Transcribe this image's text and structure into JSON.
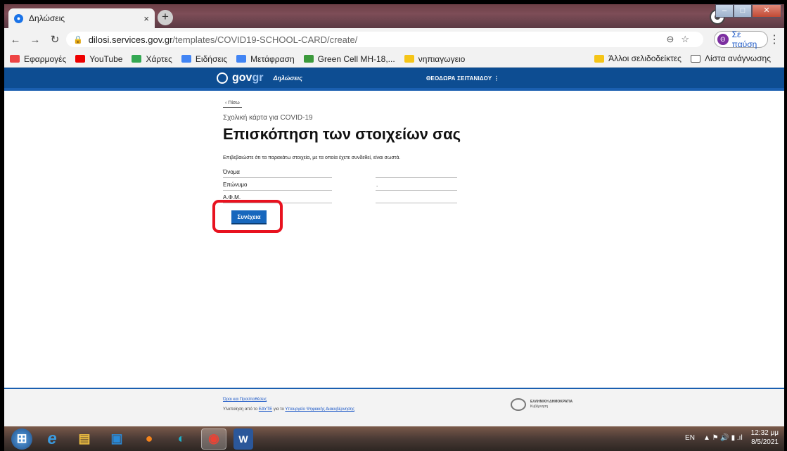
{
  "browser": {
    "tab_title": "Δηλώσεις",
    "tab_close": "×",
    "new_tab": "+",
    "url_domain": "dilosi.services.gov.gr",
    "url_path": "/templates/COVID19-SCHOOL-CARD/create/",
    "profile_button": "Σε παύση",
    "profile_initial": "Θ",
    "bookmarks": [
      {
        "label": "Εφαρμογές",
        "color": "#e44"
      },
      {
        "label": "YouTube",
        "color": "#e00"
      },
      {
        "label": "Χάρτες",
        "color": "#34a853"
      },
      {
        "label": "Ειδήσεις",
        "color": "#4285f4"
      },
      {
        "label": "Μετάφραση",
        "color": "#4285f4"
      },
      {
        "label": "Green Cell MH-18,...",
        "color": "#3c9a3c"
      },
      {
        "label": "νηπιαγωγειο",
        "color": "#f5c518"
      }
    ],
    "bookmarks_other": "Άλλοι σελιδοδείκτες",
    "reading_list": "Λίστα ανάγνωσης"
  },
  "header": {
    "logo_gov": "gov",
    "logo_gr": "gr",
    "app_name": "Δηλώσεις",
    "user_name": "ΘΕΟΔΩΡΑ ΣΕΙΤΑΝΙΔΟΥ",
    "user_menu": "⋮"
  },
  "main": {
    "back_label": "‹ Πίσω",
    "caption": "Σχολική κάρτα για COVID-19",
    "title": "Επισκόπηση των στοιχείων σας",
    "lead": "Επιβεβαιώστε ότι τα παρακάτω στοιχεία, με τα οποία έχετε συνδεθεί, είναι σωστά.",
    "rows": [
      {
        "label": "Όνομα",
        "value": ""
      },
      {
        "label": "Επώνυμο",
        "value": "."
      },
      {
        "label": "Α.Φ.Μ.",
        "value": ""
      }
    ],
    "continue_label": "Συνέχεια"
  },
  "footer": {
    "terms": "Όροι και Προϋποθέσεις",
    "impl_prefix": "Υλοποίηση από το",
    "impl_org": "ΕΔΥΤΕ",
    "impl_mid": "για το",
    "impl_ministry": "Υπουργείο Ψηφιακής Διακυβέρνησης",
    "gov_name": "ΕΛΛΗΝΙΚΗ ΔΗΜΟΚΡΑΤΙΑ",
    "gov_sub": "Κυβέρνηση"
  },
  "taskbar": {
    "lang": "EN",
    "time": "12:32 μμ",
    "date": "8/5/2021"
  },
  "colors": {
    "gov_blue": "#0d4d92",
    "button_blue": "#1767bd",
    "highlight_red": "#e8121f"
  }
}
